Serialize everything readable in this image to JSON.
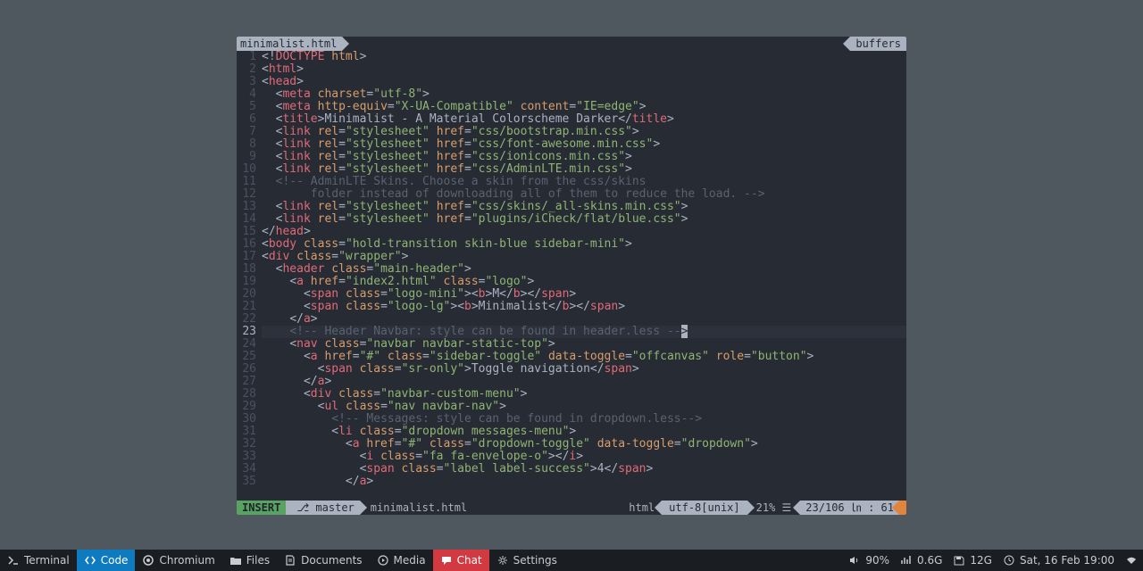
{
  "tabline": {
    "filename": "minimalist.html",
    "right": "buffers"
  },
  "gutter_start": 1,
  "gutter_end": 35,
  "current_line": 23,
  "statusline": {
    "mode": "INSERT",
    "branch": "master",
    "filename": "minimalist.html",
    "filetype": "html",
    "encoding": "utf-8[unix]",
    "percent": "21% ☰",
    "position": "23/106 ㏑ : 61"
  },
  "code": [
    [
      [
        "angle",
        "<!"
      ],
      [
        "tag",
        "DOCTYPE "
      ],
      [
        "attr",
        "html"
      ],
      [
        "angle",
        ">"
      ]
    ],
    [
      [
        "angle",
        "<"
      ],
      [
        "tag",
        "html"
      ],
      [
        "angle",
        ">"
      ]
    ],
    [
      [
        "angle",
        "<"
      ],
      [
        "tag",
        "head"
      ],
      [
        "angle",
        ">"
      ]
    ],
    [
      [
        "text",
        "  "
      ],
      [
        "angle",
        "<"
      ],
      [
        "tag",
        "meta"
      ],
      [
        "text",
        " "
      ],
      [
        "attr",
        "charset"
      ],
      [
        "text",
        "="
      ],
      [
        "str",
        "\"utf-8\""
      ],
      [
        "angle",
        ">"
      ]
    ],
    [
      [
        "text",
        "  "
      ],
      [
        "angle",
        "<"
      ],
      [
        "tag",
        "meta"
      ],
      [
        "text",
        " "
      ],
      [
        "attr",
        "http-equiv"
      ],
      [
        "text",
        "="
      ],
      [
        "str",
        "\"X-UA-Compatible\""
      ],
      [
        "text",
        " "
      ],
      [
        "attr",
        "content"
      ],
      [
        "text",
        "="
      ],
      [
        "str",
        "\"IE=edge\""
      ],
      [
        "angle",
        ">"
      ]
    ],
    [
      [
        "text",
        "  "
      ],
      [
        "angle",
        "<"
      ],
      [
        "tag",
        "title"
      ],
      [
        "angle",
        ">"
      ],
      [
        "text",
        "Minimalist - A Material Colorscheme Darker"
      ],
      [
        "angle",
        "</"
      ],
      [
        "tag",
        "title"
      ],
      [
        "angle",
        ">"
      ]
    ],
    [
      [
        "text",
        "  "
      ],
      [
        "angle",
        "<"
      ],
      [
        "tag",
        "link"
      ],
      [
        "text",
        " "
      ],
      [
        "attr",
        "rel"
      ],
      [
        "text",
        "="
      ],
      [
        "str",
        "\"stylesheet\""
      ],
      [
        "text",
        " "
      ],
      [
        "attr",
        "href"
      ],
      [
        "text",
        "="
      ],
      [
        "str",
        "\"css/bootstrap.min.css\""
      ],
      [
        "angle",
        ">"
      ]
    ],
    [
      [
        "text",
        "  "
      ],
      [
        "angle",
        "<"
      ],
      [
        "tag",
        "link"
      ],
      [
        "text",
        " "
      ],
      [
        "attr",
        "rel"
      ],
      [
        "text",
        "="
      ],
      [
        "str",
        "\"stylesheet\""
      ],
      [
        "text",
        " "
      ],
      [
        "attr",
        "href"
      ],
      [
        "text",
        "="
      ],
      [
        "str",
        "\"css/font-awesome.min.css\""
      ],
      [
        "angle",
        ">"
      ]
    ],
    [
      [
        "text",
        "  "
      ],
      [
        "angle",
        "<"
      ],
      [
        "tag",
        "link"
      ],
      [
        "text",
        " "
      ],
      [
        "attr",
        "rel"
      ],
      [
        "text",
        "="
      ],
      [
        "str",
        "\"stylesheet\""
      ],
      [
        "text",
        " "
      ],
      [
        "attr",
        "href"
      ],
      [
        "text",
        "="
      ],
      [
        "str",
        "\"css/ionicons.min.css\""
      ],
      [
        "angle",
        ">"
      ]
    ],
    [
      [
        "text",
        "  "
      ],
      [
        "angle",
        "<"
      ],
      [
        "tag",
        "link"
      ],
      [
        "text",
        " "
      ],
      [
        "attr",
        "rel"
      ],
      [
        "text",
        "="
      ],
      [
        "str",
        "\"stylesheet\""
      ],
      [
        "text",
        " "
      ],
      [
        "attr",
        "href"
      ],
      [
        "text",
        "="
      ],
      [
        "str",
        "\"css/AdminLTE.min.css\""
      ],
      [
        "angle",
        ">"
      ]
    ],
    [
      [
        "text",
        "  "
      ],
      [
        "comment",
        "<!-- AdminLTE Skins. Choose a skin from the css/skins"
      ]
    ],
    [
      [
        "text",
        "       "
      ],
      [
        "comment",
        "folder instead of downloading all of them to reduce the load. -->"
      ]
    ],
    [
      [
        "text",
        "  "
      ],
      [
        "angle",
        "<"
      ],
      [
        "tag",
        "link"
      ],
      [
        "text",
        " "
      ],
      [
        "attr",
        "rel"
      ],
      [
        "text",
        "="
      ],
      [
        "str",
        "\"stylesheet\""
      ],
      [
        "text",
        " "
      ],
      [
        "attr",
        "href"
      ],
      [
        "text",
        "="
      ],
      [
        "str",
        "\"css/skins/_all-skins.min.css\""
      ],
      [
        "angle",
        ">"
      ]
    ],
    [
      [
        "text",
        "  "
      ],
      [
        "angle",
        "<"
      ],
      [
        "tag",
        "link"
      ],
      [
        "text",
        " "
      ],
      [
        "attr",
        "rel"
      ],
      [
        "text",
        "="
      ],
      [
        "str",
        "\"stylesheet\""
      ],
      [
        "text",
        " "
      ],
      [
        "attr",
        "href"
      ],
      [
        "text",
        "="
      ],
      [
        "str",
        "\"plugins/iCheck/flat/blue.css\""
      ],
      [
        "angle",
        ">"
      ]
    ],
    [
      [
        "angle",
        "</"
      ],
      [
        "tag",
        "head"
      ],
      [
        "angle",
        ">"
      ]
    ],
    [
      [
        "angle",
        "<"
      ],
      [
        "tag",
        "body"
      ],
      [
        "text",
        " "
      ],
      [
        "attr",
        "class"
      ],
      [
        "text",
        "="
      ],
      [
        "str",
        "\"hold-transition skin-blue sidebar-mini\""
      ],
      [
        "angle",
        ">"
      ]
    ],
    [
      [
        "angle",
        "<"
      ],
      [
        "tag",
        "div"
      ],
      [
        "text",
        " "
      ],
      [
        "attr",
        "class"
      ],
      [
        "text",
        "="
      ],
      [
        "str",
        "\"wrapper\""
      ],
      [
        "angle",
        ">"
      ]
    ],
    [
      [
        "text",
        "  "
      ],
      [
        "angle",
        "<"
      ],
      [
        "tag",
        "header"
      ],
      [
        "text",
        " "
      ],
      [
        "attr",
        "class"
      ],
      [
        "text",
        "="
      ],
      [
        "str",
        "\"main-header\""
      ],
      [
        "angle",
        ">"
      ]
    ],
    [
      [
        "text",
        "    "
      ],
      [
        "angle",
        "<"
      ],
      [
        "tag",
        "a"
      ],
      [
        "text",
        " "
      ],
      [
        "attr",
        "href"
      ],
      [
        "text",
        "="
      ],
      [
        "str",
        "\"index2.html\""
      ],
      [
        "text",
        " "
      ],
      [
        "attr",
        "class"
      ],
      [
        "text",
        "="
      ],
      [
        "str",
        "\"logo\""
      ],
      [
        "angle",
        ">"
      ]
    ],
    [
      [
        "text",
        "      "
      ],
      [
        "angle",
        "<"
      ],
      [
        "tag",
        "span"
      ],
      [
        "text",
        " "
      ],
      [
        "attr",
        "class"
      ],
      [
        "text",
        "="
      ],
      [
        "str",
        "\"logo-mini\""
      ],
      [
        "angle",
        ">"
      ],
      [
        "angle",
        "<"
      ],
      [
        "tag",
        "b"
      ],
      [
        "angle",
        ">"
      ],
      [
        "text",
        "M"
      ],
      [
        "angle",
        "</"
      ],
      [
        "tag",
        "b"
      ],
      [
        "angle",
        ">"
      ],
      [
        "angle",
        "</"
      ],
      [
        "tag",
        "span"
      ],
      [
        "angle",
        ">"
      ]
    ],
    [
      [
        "text",
        "      "
      ],
      [
        "angle",
        "<"
      ],
      [
        "tag",
        "span"
      ],
      [
        "text",
        " "
      ],
      [
        "attr",
        "class"
      ],
      [
        "text",
        "="
      ],
      [
        "str",
        "\"logo-lg\""
      ],
      [
        "angle",
        ">"
      ],
      [
        "angle",
        "<"
      ],
      [
        "tag",
        "b"
      ],
      [
        "angle",
        ">"
      ],
      [
        "text",
        "Minimalist"
      ],
      [
        "angle",
        "</"
      ],
      [
        "tag",
        "b"
      ],
      [
        "angle",
        ">"
      ],
      [
        "angle",
        "</"
      ],
      [
        "tag",
        "span"
      ],
      [
        "angle",
        ">"
      ]
    ],
    [
      [
        "text",
        "    "
      ],
      [
        "angle",
        "</"
      ],
      [
        "tag",
        "a"
      ],
      [
        "angle",
        ">"
      ]
    ],
    [
      [
        "text",
        "    "
      ],
      [
        "comment",
        "<!-- Header Navbar: style can be found in header.less --"
      ],
      [
        "cursor",
        ">"
      ]
    ],
    [
      [
        "text",
        "    "
      ],
      [
        "angle",
        "<"
      ],
      [
        "tag",
        "nav"
      ],
      [
        "text",
        " "
      ],
      [
        "attr",
        "class"
      ],
      [
        "text",
        "="
      ],
      [
        "str",
        "\"navbar navbar-static-top\""
      ],
      [
        "angle",
        ">"
      ]
    ],
    [
      [
        "text",
        "      "
      ],
      [
        "angle",
        "<"
      ],
      [
        "tag",
        "a"
      ],
      [
        "text",
        " "
      ],
      [
        "attr",
        "href"
      ],
      [
        "text",
        "="
      ],
      [
        "str",
        "\"#\""
      ],
      [
        "text",
        " "
      ],
      [
        "attr",
        "class"
      ],
      [
        "text",
        "="
      ],
      [
        "str",
        "\"sidebar-toggle\""
      ],
      [
        "text",
        " "
      ],
      [
        "attr",
        "data-toggle"
      ],
      [
        "text",
        "="
      ],
      [
        "str",
        "\"offcanvas\""
      ],
      [
        "text",
        " "
      ],
      [
        "attr",
        "role"
      ],
      [
        "text",
        "="
      ],
      [
        "str",
        "\"button\""
      ],
      [
        "angle",
        ">"
      ]
    ],
    [
      [
        "text",
        "        "
      ],
      [
        "angle",
        "<"
      ],
      [
        "tag",
        "span"
      ],
      [
        "text",
        " "
      ],
      [
        "attr",
        "class"
      ],
      [
        "text",
        "="
      ],
      [
        "str",
        "\"sr-only\""
      ],
      [
        "angle",
        ">"
      ],
      [
        "text",
        "Toggle navigation"
      ],
      [
        "angle",
        "</"
      ],
      [
        "tag",
        "span"
      ],
      [
        "angle",
        ">"
      ]
    ],
    [
      [
        "text",
        "      "
      ],
      [
        "angle",
        "</"
      ],
      [
        "tag",
        "a"
      ],
      [
        "angle",
        ">"
      ]
    ],
    [
      [
        "text",
        "      "
      ],
      [
        "angle",
        "<"
      ],
      [
        "tag",
        "div"
      ],
      [
        "text",
        " "
      ],
      [
        "attr",
        "class"
      ],
      [
        "text",
        "="
      ],
      [
        "str",
        "\"navbar-custom-menu\""
      ],
      [
        "angle",
        ">"
      ]
    ],
    [
      [
        "text",
        "        "
      ],
      [
        "angle",
        "<"
      ],
      [
        "tag",
        "ul"
      ],
      [
        "text",
        " "
      ],
      [
        "attr",
        "class"
      ],
      [
        "text",
        "="
      ],
      [
        "str",
        "\"nav navbar-nav\""
      ],
      [
        "angle",
        ">"
      ]
    ],
    [
      [
        "text",
        "          "
      ],
      [
        "comment",
        "<!-- Messages: style can be found in dropdown.less-->"
      ]
    ],
    [
      [
        "text",
        "          "
      ],
      [
        "angle",
        "<"
      ],
      [
        "tag",
        "li"
      ],
      [
        "text",
        " "
      ],
      [
        "attr",
        "class"
      ],
      [
        "text",
        "="
      ],
      [
        "str",
        "\"dropdown messages-menu\""
      ],
      [
        "angle",
        ">"
      ]
    ],
    [
      [
        "text",
        "            "
      ],
      [
        "angle",
        "<"
      ],
      [
        "tag",
        "a"
      ],
      [
        "text",
        " "
      ],
      [
        "attr",
        "href"
      ],
      [
        "text",
        "="
      ],
      [
        "str",
        "\"#\""
      ],
      [
        "text",
        " "
      ],
      [
        "attr",
        "class"
      ],
      [
        "text",
        "="
      ],
      [
        "str",
        "\"dropdown-toggle\""
      ],
      [
        "text",
        " "
      ],
      [
        "attr",
        "data-toggle"
      ],
      [
        "text",
        "="
      ],
      [
        "str",
        "\"dropdown\""
      ],
      [
        "angle",
        ">"
      ]
    ],
    [
      [
        "text",
        "              "
      ],
      [
        "angle",
        "<"
      ],
      [
        "tag",
        "i"
      ],
      [
        "text",
        " "
      ],
      [
        "attr",
        "class"
      ],
      [
        "text",
        "="
      ],
      [
        "str",
        "\"fa fa-envelope-o\""
      ],
      [
        "angle",
        ">"
      ],
      [
        "angle",
        "</"
      ],
      [
        "tag",
        "i"
      ],
      [
        "angle",
        ">"
      ]
    ],
    [
      [
        "text",
        "              "
      ],
      [
        "angle",
        "<"
      ],
      [
        "tag",
        "span"
      ],
      [
        "text",
        " "
      ],
      [
        "attr",
        "class"
      ],
      [
        "text",
        "="
      ],
      [
        "str",
        "\"label label-success\""
      ],
      [
        "angle",
        ">"
      ],
      [
        "text",
        "4"
      ],
      [
        "angle",
        "</"
      ],
      [
        "tag",
        "span"
      ],
      [
        "angle",
        ">"
      ]
    ],
    [
      [
        "text",
        "            "
      ],
      [
        "angle",
        "</"
      ],
      [
        "tag",
        "a"
      ],
      [
        "angle",
        ">"
      ]
    ]
  ],
  "taskbar": {
    "left": [
      {
        "icon": "terminal",
        "label": "Terminal"
      },
      {
        "icon": "code",
        "label": "Code",
        "cls": "active-blue"
      },
      {
        "icon": "chromium",
        "label": "Chromium"
      },
      {
        "icon": "folder",
        "label": "Files"
      },
      {
        "icon": "doc",
        "label": "Documents"
      },
      {
        "icon": "media",
        "label": "Media"
      },
      {
        "icon": "chat",
        "label": "Chat",
        "cls": "active-red"
      },
      {
        "icon": "gear",
        "label": "Settings"
      }
    ],
    "right": [
      {
        "icon": "volume",
        "label": "90%"
      },
      {
        "icon": "chart",
        "label": "0.6G"
      },
      {
        "icon": "disk",
        "label": "12G"
      },
      {
        "icon": "clock",
        "label": "Sat, 16 Feb 19:00"
      },
      {
        "icon": "wifi",
        "label": ""
      }
    ]
  }
}
